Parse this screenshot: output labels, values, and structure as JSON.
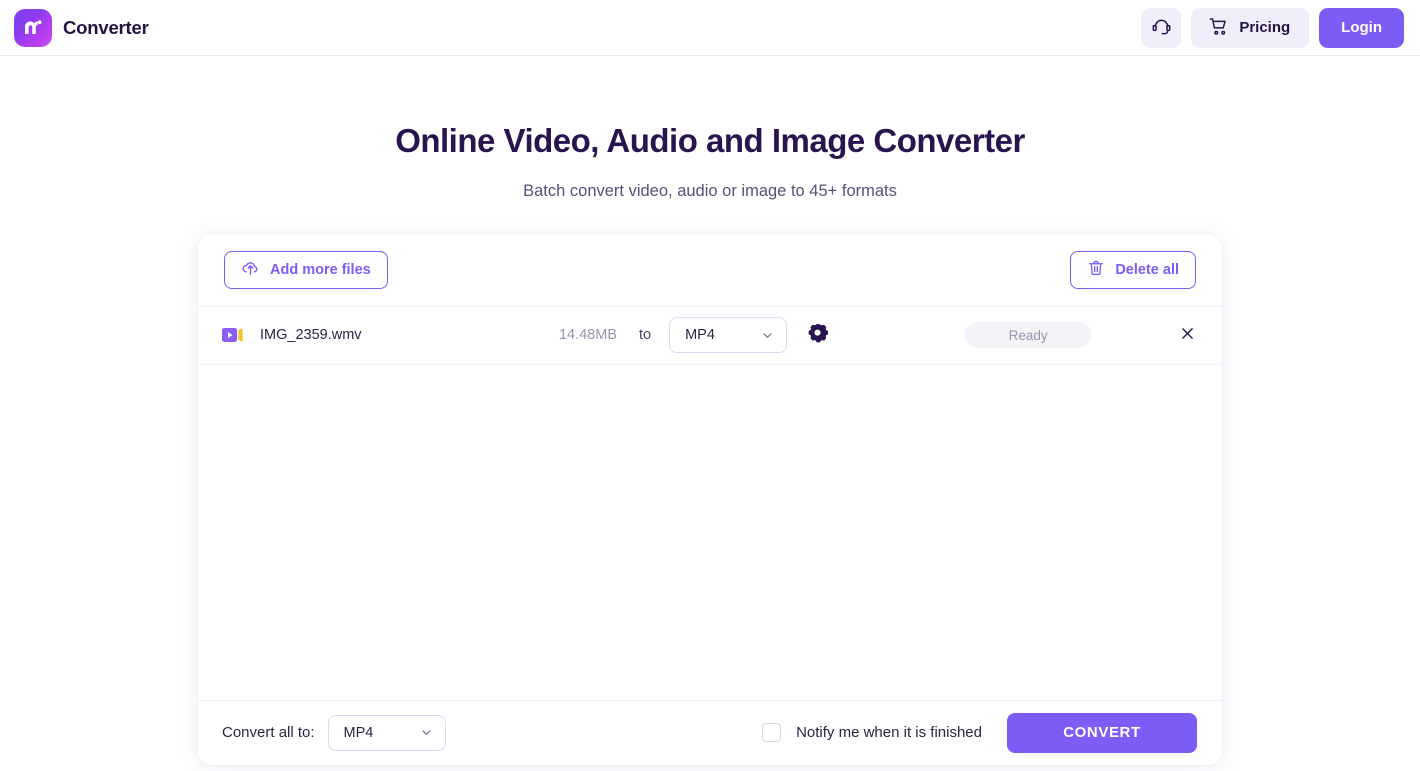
{
  "header": {
    "brand_name": "Converter",
    "logo_icon": "m-logo-icon",
    "support_icon": "headset-icon",
    "pricing_icon": "shopping-cart-icon",
    "pricing_label": "Pricing",
    "login_label": "Login",
    "accent_color": "#7c5cf5",
    "button_bg": "#f1eefb"
  },
  "hero": {
    "title": "Online Video, Audio and Image Converter",
    "subtitle": "Batch convert video, audio or image to 45+ formats"
  },
  "toolbar": {
    "add_files_label": "Add more files",
    "add_files_icon": "cloud-upload-icon",
    "delete_all_label": "Delete all",
    "delete_all_icon": "trash-icon"
  },
  "files": [
    {
      "type_icon": "video-file-icon",
      "name": "IMG_2359.wmv",
      "size": "14.48MB",
      "to_label": "to",
      "target_format": "MP4",
      "settings_icon": "gear-icon",
      "status": "Ready",
      "remove_icon": "close-icon"
    }
  ],
  "footer": {
    "convert_all_label": "Convert all to:",
    "convert_all_format": "MP4",
    "notify_label": "Notify me when it is finished",
    "notify_checked": false,
    "convert_button_label": "CONVERT"
  }
}
